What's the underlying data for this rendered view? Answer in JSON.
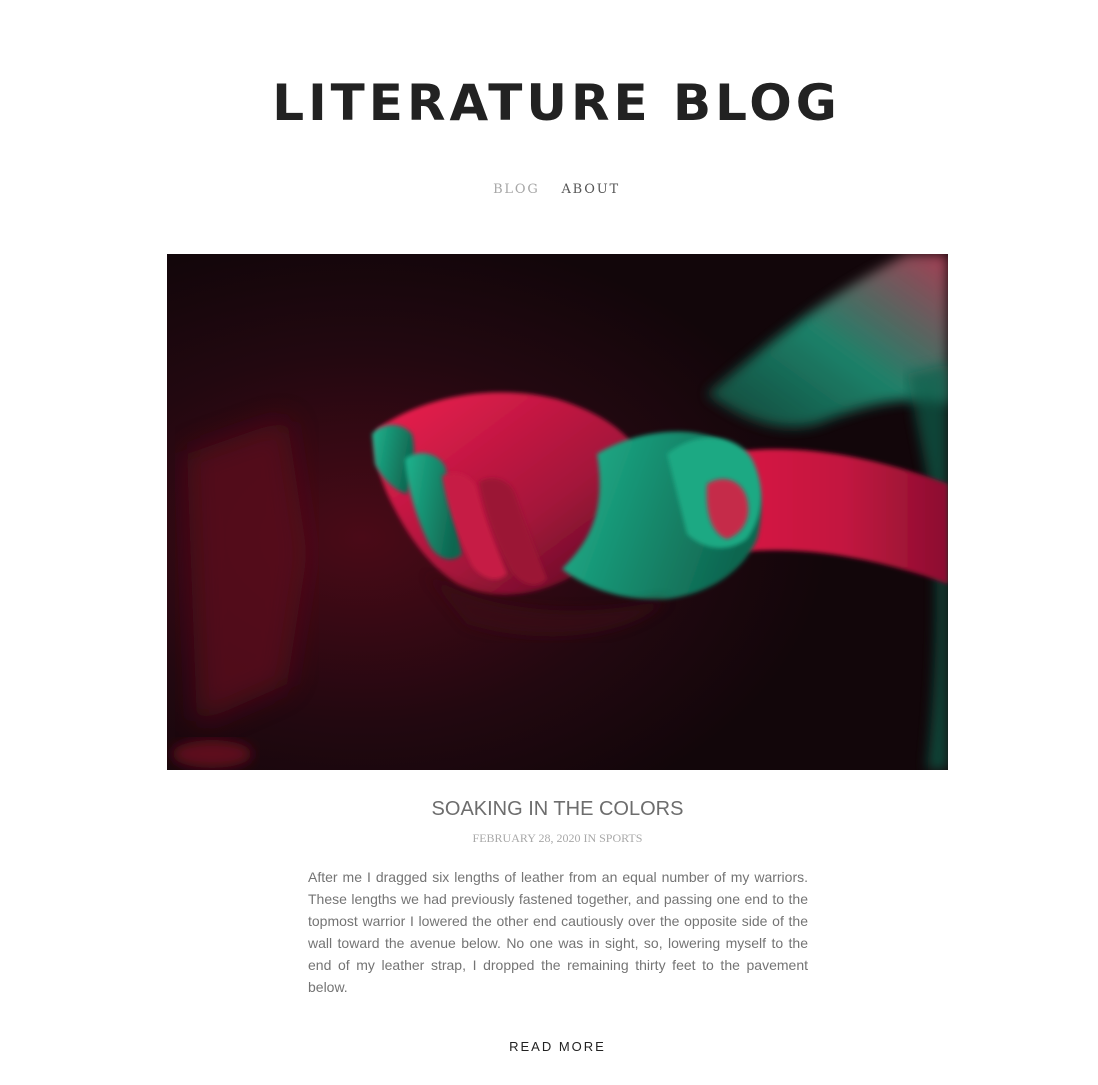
{
  "site": {
    "title": "LITERATURE BLOG"
  },
  "nav": {
    "items": [
      {
        "label": "BLOG"
      },
      {
        "label": "ABOUT"
      }
    ]
  },
  "post": {
    "image": {
      "subject": "hands-photo"
    },
    "title": "SOAKING IN THE COLORS",
    "meta": {
      "date": "FEBRUARY 28, 2020",
      "in_word": "IN",
      "category": "SPORTS"
    },
    "excerpt": "After me I dragged six lengths of leather from an equal number of my warriors. These lengths we had previously fastened together, and passing one end to the topmost warrior I lowered the other end cautiously over the opposite side of the wall toward the avenue below. No one was in sight, so, lowering myself to the end of my leather strap, I dropped the remaining thirty feet to the pavement below.",
    "read_more_label": "READ MORE"
  },
  "colors": {
    "title": "#222222",
    "nav_active": "#a6a6a6",
    "nav_default": "#555555",
    "post_title": "#6d6d6d",
    "meta": "#a8a8a8",
    "body_text": "#747474",
    "photo_red": "#e0103f",
    "photo_teal": "#18b58f",
    "photo_bg": "#140609"
  }
}
